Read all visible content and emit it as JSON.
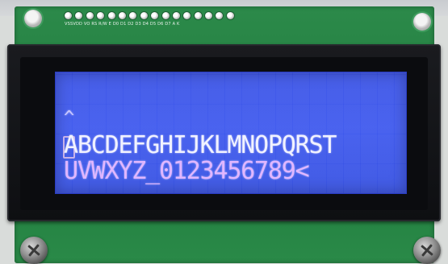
{
  "pcb": {
    "pin_labels": "VSSVDD VO RS R/W E D0 D1 D2 D3 D4 D5 D6 D7 A K",
    "colors": {
      "board": "#1f7a3d",
      "bezel": "#0e0f12",
      "lcd_backlight": "#3d58ee",
      "lcd_text": "#f1f2ff"
    }
  },
  "lcd": {
    "line1": "^",
    "line2": "ABCDEFGHIJKLMNOPQRST",
    "line3": "UVWXYZ_0123456789<"
  }
}
